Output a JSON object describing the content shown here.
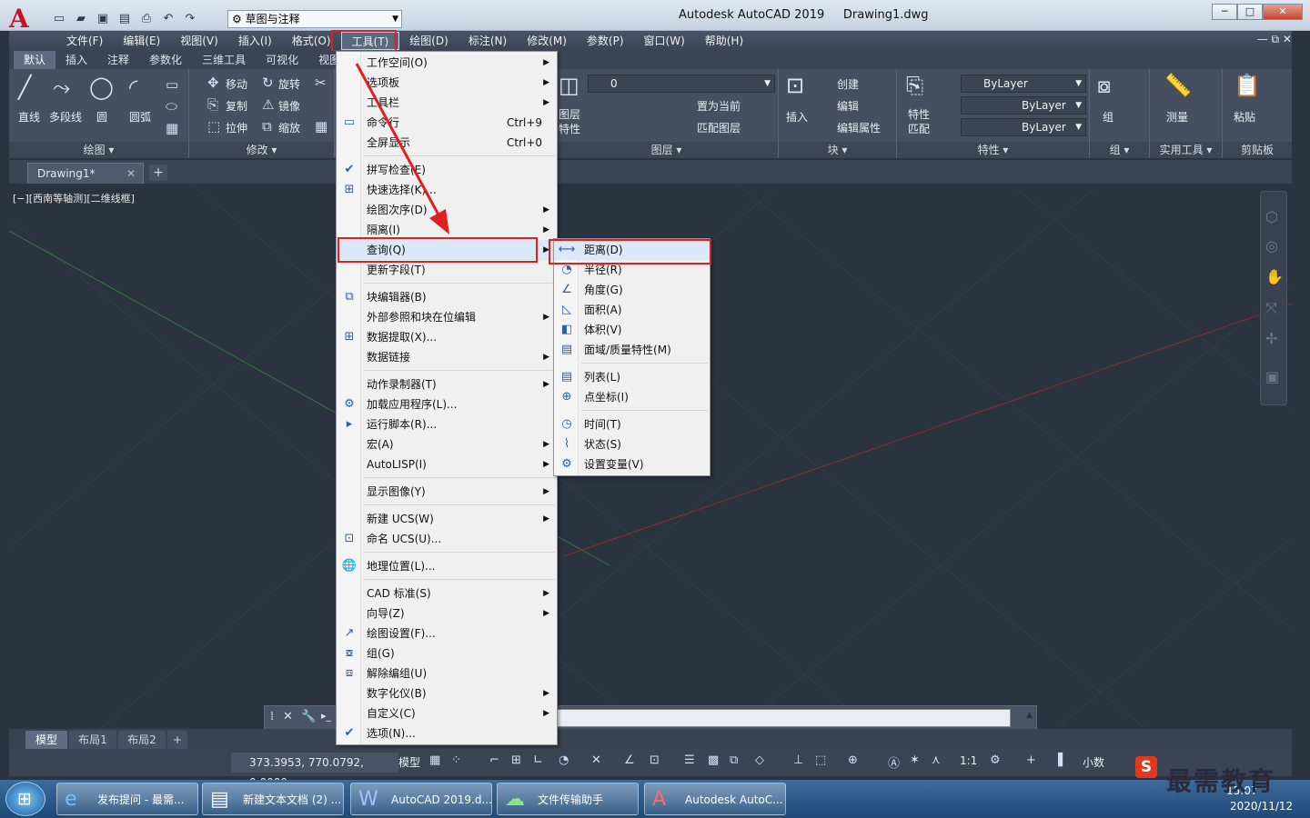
{
  "window": {
    "title": "Autodesk AutoCAD 2019",
    "filename": "Drawing1.dwg",
    "workspace": "草图与注释",
    "mdi_controls": "— ⧉ ✕"
  },
  "menubar": [
    "文件(F)",
    "编辑(E)",
    "视图(V)",
    "插入(I)",
    "格式(O)",
    "工具(T)",
    "绘图(D)",
    "标注(N)",
    "修改(M)",
    "参数(P)",
    "窗口(W)",
    "帮助(H)"
  ],
  "ribbon_tabs": [
    "默认",
    "插入",
    "注释",
    "参数化",
    "三维工具",
    "可视化",
    "视图"
  ],
  "ribbon": {
    "draw": {
      "line": "直线",
      "polyline": "多段线",
      "circle": "圆",
      "arc": "圆弧",
      "label": "绘图"
    },
    "modify": {
      "move": "移动",
      "rotate": "旋转",
      "copy": "复制",
      "mirror": "镜像",
      "stretch": "拉伸",
      "scale": "缩放",
      "label": "修改"
    },
    "layers": {
      "current_layer": "0",
      "set_current": "置为当前",
      "match_layer": "匹配图层",
      "layer_props": "图层\n特性",
      "label": "图层"
    },
    "block": {
      "insert": "插入",
      "create": "创建",
      "edit": "编辑",
      "edit_attr": "编辑属性",
      "label": "块"
    },
    "properties": {
      "match": "特性\n匹配",
      "color": "ByLayer",
      "linetype": "ByLayer",
      "lineweight": "ByLayer",
      "label": "特性"
    },
    "groups": {
      "group": "组",
      "label": "组"
    },
    "utilities": {
      "measure": "测量",
      "label": "实用工具"
    },
    "clipboard": {
      "paste": "粘贴",
      "label": "剪贴板"
    }
  },
  "doc_tab": "Drawing1*",
  "viewport_label": "[−][西南等轴测][二维线框]",
  "tools_menu": {
    "items": [
      {
        "label": "工作空间(O)",
        "sub": true
      },
      {
        "label": "选项板",
        "sub": true
      },
      {
        "label": "工具栏",
        "sub": true
      },
      {
        "label": "命令行",
        "shortcut": "Ctrl+9"
      },
      {
        "label": "全屏显示",
        "shortcut": "Ctrl+0"
      },
      {
        "label": "拼写检查(E)"
      },
      {
        "label": "快速选择(K)..."
      },
      {
        "label": "绘图次序(D)",
        "sub": true
      },
      {
        "label": "隔离(I)",
        "sub": true
      },
      {
        "label": "查询(Q)",
        "sub": true
      },
      {
        "label": "更新字段(T)"
      },
      {
        "label": "块编辑器(B)"
      },
      {
        "label": "外部参照和块在位编辑",
        "sub": true
      },
      {
        "label": "数据提取(X)..."
      },
      {
        "label": "数据链接",
        "sub": true
      },
      {
        "label": "动作录制器(T)",
        "sub": true
      },
      {
        "label": "加载应用程序(L)..."
      },
      {
        "label": "运行脚本(R)..."
      },
      {
        "label": "宏(A)",
        "sub": true
      },
      {
        "label": "AutoLISP(I)",
        "sub": true
      },
      {
        "label": "显示图像(Y)",
        "sub": true
      },
      {
        "label": "新建 UCS(W)",
        "sub": true
      },
      {
        "label": "命名 UCS(U)..."
      },
      {
        "label": "地理位置(L)..."
      },
      {
        "label": "CAD 标准(S)",
        "sub": true
      },
      {
        "label": "向导(Z)",
        "sub": true
      },
      {
        "label": "绘图设置(F)..."
      },
      {
        "label": "组(G)"
      },
      {
        "label": "解除编组(U)"
      },
      {
        "label": "数字化仪(B)",
        "sub": true
      },
      {
        "label": "自定义(C)",
        "sub": true
      },
      {
        "label": "选项(N)..."
      }
    ]
  },
  "query_menu": {
    "items": [
      "距离(D)",
      "半径(R)",
      "角度(G)",
      "面积(A)",
      "体积(V)",
      "面域/质量特性(M)",
      "列表(L)",
      "点坐标(I)",
      "时间(T)",
      "状态(S)",
      "设置变量(V)"
    ]
  },
  "layout_tabs": [
    "模型",
    "布局1",
    "布局2"
  ],
  "status": {
    "coords": "373.3953, 770.0792, 0.0000",
    "model": "模型",
    "scale": "1:1",
    "units": "小数"
  },
  "taskbar": {
    "items": [
      "发布提问 - 最需...",
      "新建文本文档 (2) ...",
      "AutoCAD 2019.d...",
      "文件传输助手",
      "Autodesk AutoC..."
    ],
    "time": "15:07",
    "date": "2020/11/12"
  },
  "watermark": {
    "logo": "S",
    "text": "最需教育"
  },
  "colors": {
    "highlight_box": "#e02020",
    "canvas": "#2b3240",
    "arrow": "#e02020"
  }
}
